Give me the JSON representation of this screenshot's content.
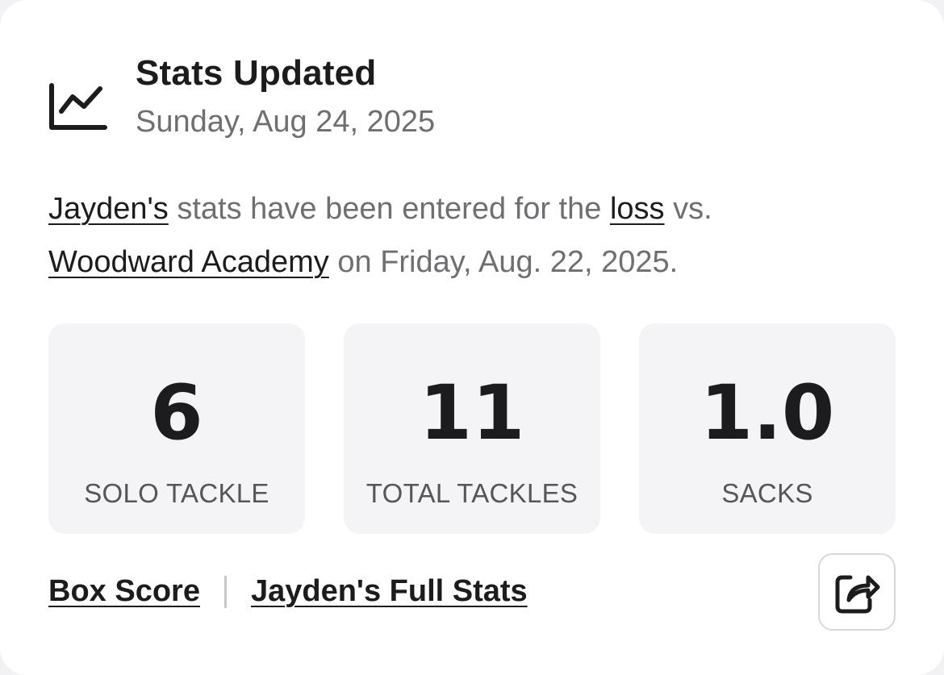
{
  "header": {
    "icon": "line-chart-icon",
    "title": "Stats Updated",
    "date": "Sunday, Aug 24, 2025"
  },
  "message": {
    "player_link": "Jayden's",
    "text_1": " stats have been entered for the ",
    "result_link": "loss",
    "text_2": " vs. ",
    "opponent_link": "Woodward Academy",
    "text_3": " on Friday, Aug. 22, 2025."
  },
  "stats": [
    {
      "value": "6",
      "label": "SOLO TACKLE"
    },
    {
      "value": "11",
      "label": "TOTAL TACKLES"
    },
    {
      "value": "1.0",
      "label": "SACKS"
    }
  ],
  "footer": {
    "box_score_label": "Box Score",
    "full_stats_label": "Jayden's Full Stats",
    "share_icon": "share-icon"
  },
  "colors": {
    "primary_text": "#1c1c1e",
    "secondary_text": "#6e6e73",
    "tile_background": "#f4f4f6",
    "card_background": "#ffffff"
  }
}
